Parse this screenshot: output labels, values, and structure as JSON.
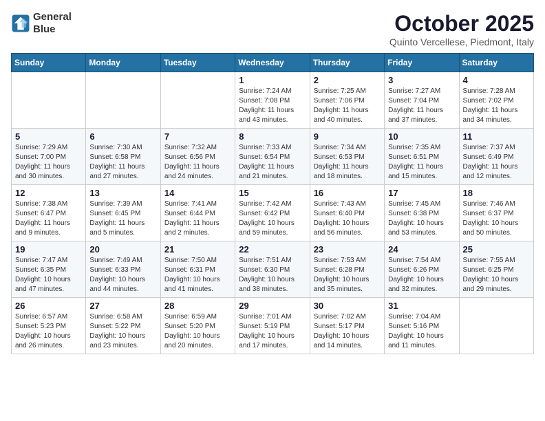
{
  "logo": {
    "line1": "General",
    "line2": "Blue"
  },
  "title": "October 2025",
  "subtitle": "Quinto Vercellese, Piedmont, Italy",
  "weekdays": [
    "Sunday",
    "Monday",
    "Tuesday",
    "Wednesday",
    "Thursday",
    "Friday",
    "Saturday"
  ],
  "weeks": [
    [
      {
        "day": "",
        "info": ""
      },
      {
        "day": "",
        "info": ""
      },
      {
        "day": "",
        "info": ""
      },
      {
        "day": "1",
        "info": "Sunrise: 7:24 AM\nSunset: 7:08 PM\nDaylight: 11 hours\nand 43 minutes."
      },
      {
        "day": "2",
        "info": "Sunrise: 7:25 AM\nSunset: 7:06 PM\nDaylight: 11 hours\nand 40 minutes."
      },
      {
        "day": "3",
        "info": "Sunrise: 7:27 AM\nSunset: 7:04 PM\nDaylight: 11 hours\nand 37 minutes."
      },
      {
        "day": "4",
        "info": "Sunrise: 7:28 AM\nSunset: 7:02 PM\nDaylight: 11 hours\nand 34 minutes."
      }
    ],
    [
      {
        "day": "5",
        "info": "Sunrise: 7:29 AM\nSunset: 7:00 PM\nDaylight: 11 hours\nand 30 minutes."
      },
      {
        "day": "6",
        "info": "Sunrise: 7:30 AM\nSunset: 6:58 PM\nDaylight: 11 hours\nand 27 minutes."
      },
      {
        "day": "7",
        "info": "Sunrise: 7:32 AM\nSunset: 6:56 PM\nDaylight: 11 hours\nand 24 minutes."
      },
      {
        "day": "8",
        "info": "Sunrise: 7:33 AM\nSunset: 6:54 PM\nDaylight: 11 hours\nand 21 minutes."
      },
      {
        "day": "9",
        "info": "Sunrise: 7:34 AM\nSunset: 6:53 PM\nDaylight: 11 hours\nand 18 minutes."
      },
      {
        "day": "10",
        "info": "Sunrise: 7:35 AM\nSunset: 6:51 PM\nDaylight: 11 hours\nand 15 minutes."
      },
      {
        "day": "11",
        "info": "Sunrise: 7:37 AM\nSunset: 6:49 PM\nDaylight: 11 hours\nand 12 minutes."
      }
    ],
    [
      {
        "day": "12",
        "info": "Sunrise: 7:38 AM\nSunset: 6:47 PM\nDaylight: 11 hours\nand 9 minutes."
      },
      {
        "day": "13",
        "info": "Sunrise: 7:39 AM\nSunset: 6:45 PM\nDaylight: 11 hours\nand 5 minutes."
      },
      {
        "day": "14",
        "info": "Sunrise: 7:41 AM\nSunset: 6:44 PM\nDaylight: 11 hours\nand 2 minutes."
      },
      {
        "day": "15",
        "info": "Sunrise: 7:42 AM\nSunset: 6:42 PM\nDaylight: 10 hours\nand 59 minutes."
      },
      {
        "day": "16",
        "info": "Sunrise: 7:43 AM\nSunset: 6:40 PM\nDaylight: 10 hours\nand 56 minutes."
      },
      {
        "day": "17",
        "info": "Sunrise: 7:45 AM\nSunset: 6:38 PM\nDaylight: 10 hours\nand 53 minutes."
      },
      {
        "day": "18",
        "info": "Sunrise: 7:46 AM\nSunset: 6:37 PM\nDaylight: 10 hours\nand 50 minutes."
      }
    ],
    [
      {
        "day": "19",
        "info": "Sunrise: 7:47 AM\nSunset: 6:35 PM\nDaylight: 10 hours\nand 47 minutes."
      },
      {
        "day": "20",
        "info": "Sunrise: 7:49 AM\nSunset: 6:33 PM\nDaylight: 10 hours\nand 44 minutes."
      },
      {
        "day": "21",
        "info": "Sunrise: 7:50 AM\nSunset: 6:31 PM\nDaylight: 10 hours\nand 41 minutes."
      },
      {
        "day": "22",
        "info": "Sunrise: 7:51 AM\nSunset: 6:30 PM\nDaylight: 10 hours\nand 38 minutes."
      },
      {
        "day": "23",
        "info": "Sunrise: 7:53 AM\nSunset: 6:28 PM\nDaylight: 10 hours\nand 35 minutes."
      },
      {
        "day": "24",
        "info": "Sunrise: 7:54 AM\nSunset: 6:26 PM\nDaylight: 10 hours\nand 32 minutes."
      },
      {
        "day": "25",
        "info": "Sunrise: 7:55 AM\nSunset: 6:25 PM\nDaylight: 10 hours\nand 29 minutes."
      }
    ],
    [
      {
        "day": "26",
        "info": "Sunrise: 6:57 AM\nSunset: 5:23 PM\nDaylight: 10 hours\nand 26 minutes."
      },
      {
        "day": "27",
        "info": "Sunrise: 6:58 AM\nSunset: 5:22 PM\nDaylight: 10 hours\nand 23 minutes."
      },
      {
        "day": "28",
        "info": "Sunrise: 6:59 AM\nSunset: 5:20 PM\nDaylight: 10 hours\nand 20 minutes."
      },
      {
        "day": "29",
        "info": "Sunrise: 7:01 AM\nSunset: 5:19 PM\nDaylight: 10 hours\nand 17 minutes."
      },
      {
        "day": "30",
        "info": "Sunrise: 7:02 AM\nSunset: 5:17 PM\nDaylight: 10 hours\nand 14 minutes."
      },
      {
        "day": "31",
        "info": "Sunrise: 7:04 AM\nSunset: 5:16 PM\nDaylight: 10 hours\nand 11 minutes."
      },
      {
        "day": "",
        "info": ""
      }
    ]
  ]
}
